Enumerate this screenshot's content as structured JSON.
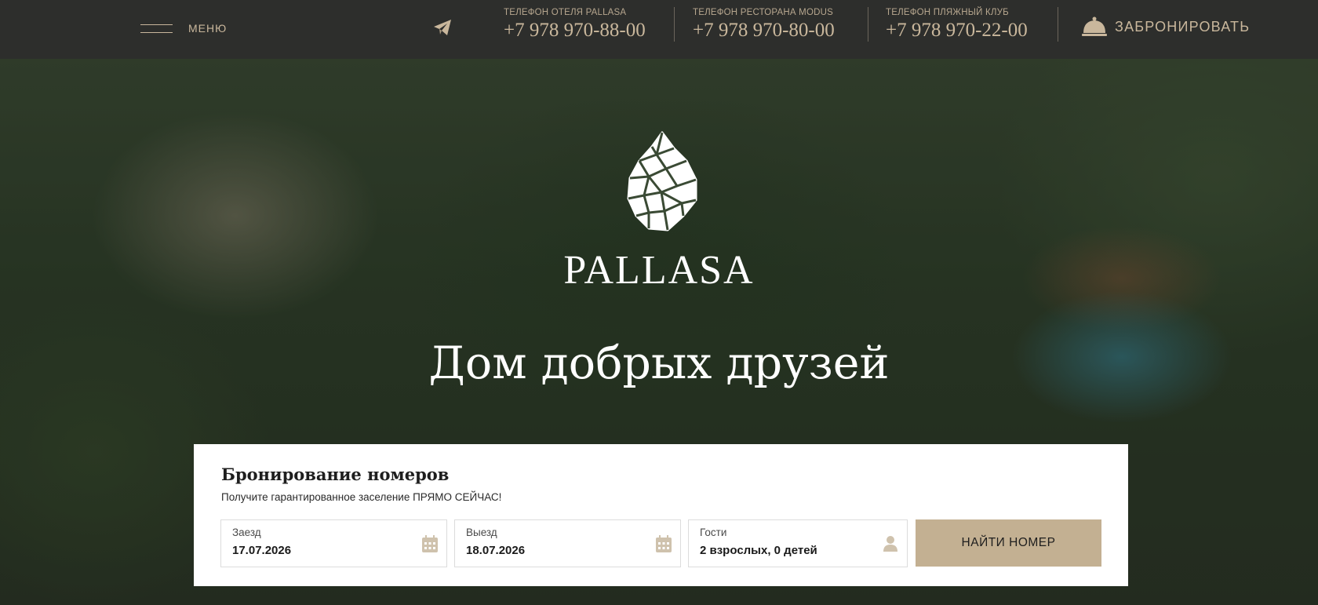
{
  "header": {
    "menu_label": "МЕНЮ",
    "telegram_icon": "telegram-icon",
    "phones": [
      {
        "label": "ТЕЛЕФОН ОТЕЛЯ PALLASA",
        "number": "+7 978 970-88-00"
      },
      {
        "label": "ТЕЛЕФОН РЕСТОРАНА MODUS",
        "number": "+7 978 970-80-00"
      },
      {
        "label": "ТЕЛЕФОН ПЛЯЖНЫЙ КЛУБ",
        "number": "+7 978 970-22-00"
      }
    ],
    "book_icon": "service-bell-icon",
    "book_label": "ЗАБРОНИРОВАТЬ"
  },
  "hero": {
    "logo_icon": "pinecone-logo-icon",
    "brand": "PALLASA",
    "tagline": "Дом добрых друзей"
  },
  "booking": {
    "title": "Бронирование номеров",
    "subtitle": "Получите гарантированное заселение ПРЯМО СЕЙЧАС!",
    "checkin": {
      "label": "Заезд",
      "value": "17.07.2026",
      "icon": "calendar-icon"
    },
    "checkout": {
      "label": "Выезд",
      "value": "18.07.2026",
      "icon": "calendar-icon"
    },
    "guests": {
      "label": "Гости",
      "value": "2 взрослых, 0 детей",
      "icon": "user-icon"
    },
    "search_label": "НАЙТИ НОМЕР"
  },
  "colors": {
    "header_bg": "#2d2e2c",
    "accent_gold": "#c9b79c",
    "button_bg": "#c3b092"
  }
}
